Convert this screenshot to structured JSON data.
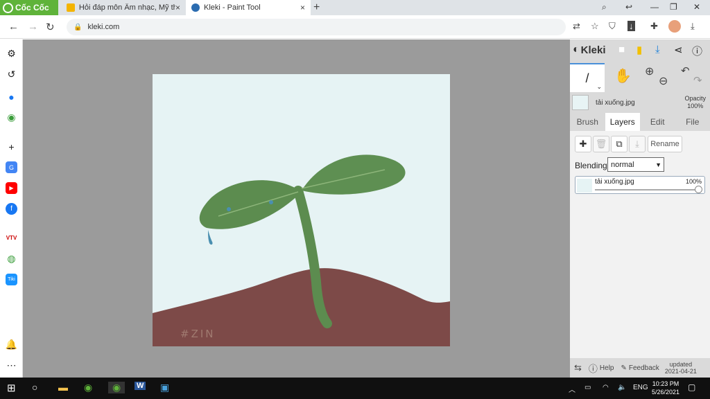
{
  "browser": {
    "brand": "Cốc Cốc",
    "tabs": [
      {
        "title": "Hỏi đáp môn Âm nhạc, Mỹ thu",
        "close": "×"
      },
      {
        "title": "Kleki - Paint Tool",
        "close": "×"
      }
    ],
    "new_tab": "+",
    "url": "kleki.com"
  },
  "kleki": {
    "logo_text": "Kleki",
    "file_name": "tải xuống.jpg",
    "opacity_label": "Opacity",
    "opacity_value": "100%",
    "tabs": [
      "Brush",
      "Layers",
      "Edit",
      "File"
    ],
    "active_tab": "Layers",
    "rename_label": "Rename",
    "blending_label": "Blending",
    "blending_value": "normal",
    "layer": {
      "name": "tải xuống.jpg",
      "opacity": "100%",
      "opacity_fraction": 1.0
    },
    "footer": {
      "help": "Help",
      "feedback": "Feedback",
      "updated_label": "updated",
      "updated_date": "2021-04-21"
    }
  },
  "canvas": {
    "signature": "#ZIN"
  },
  "taskbar": {
    "lang": "ENG",
    "time": "10:23 PM",
    "date": "5/26/2021"
  },
  "colors": {
    "brand_green": "#5fb33a",
    "accent_blue": "#4a90d9",
    "soil": "#7d4a48",
    "leaf": "#5c8c4f"
  }
}
